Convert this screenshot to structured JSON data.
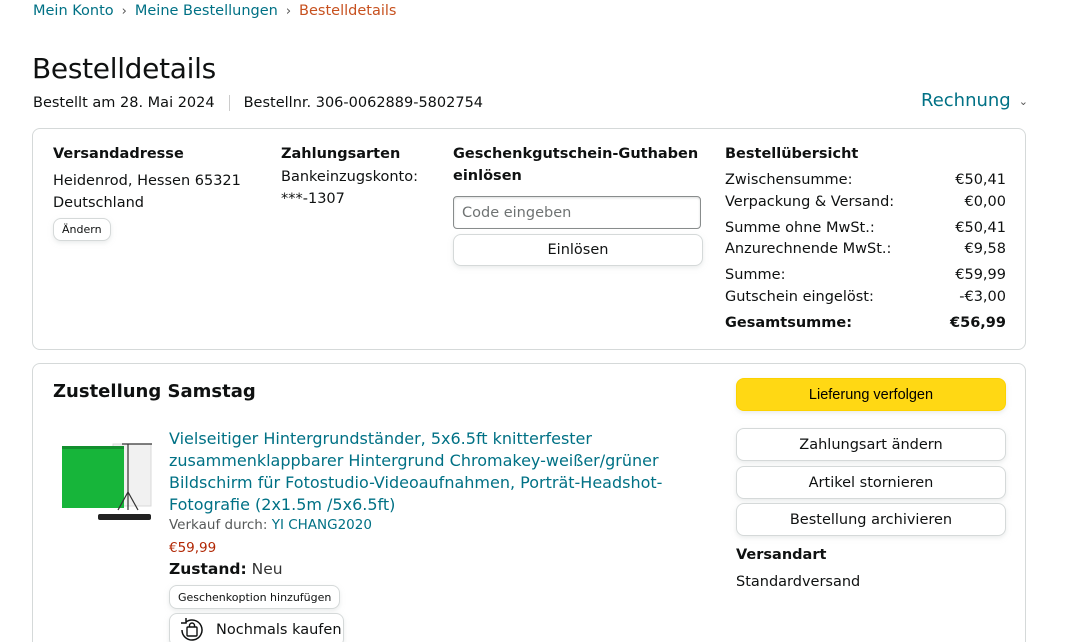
{
  "breadcrumb": {
    "items": [
      "Mein Konto",
      "Meine Bestellungen"
    ],
    "current": "Bestelldetails",
    "separator": "›"
  },
  "page_title": "Bestelldetails",
  "order_meta": {
    "date": "Bestellt am 28. Mai 2024",
    "number": "Bestellnr. 306-0062889-5802754"
  },
  "invoice_label": "Rechnung",
  "shipping": {
    "heading": "Versandadresse",
    "line1": "Heidenrod, Hessen 65321",
    "line2": "Deutschland",
    "change_label": "Ändern"
  },
  "payment": {
    "heading": "Zahlungsarten",
    "method": "Bankeinzugskonto:",
    "account": "***-1307"
  },
  "gift_card": {
    "heading_line1": "Geschenkgutschein-Guthaben",
    "heading_line2": "einlösen",
    "placeholder": "Code eingeben",
    "redeem_label": "Einlösen"
  },
  "summary": {
    "heading": "Bestellübersicht",
    "rows": [
      {
        "label": "Zwischensumme:",
        "value": "€50,41"
      },
      {
        "label": "Verpackung & Versand:",
        "value": "€0,00"
      },
      {
        "label": "Summe ohne MwSt.:",
        "value": "€50,41"
      },
      {
        "label": "Anzurechnende MwSt.:",
        "value": "€9,58"
      },
      {
        "label": "Summe:",
        "value": "€59,99"
      },
      {
        "label": "Gutschein eingelöst:",
        "value": "-€3,00"
      }
    ],
    "total": {
      "label": "Gesamtsumme:",
      "value": "€56,99"
    }
  },
  "delivery": {
    "heading": "Zustellung Samstag",
    "product": {
      "title_lines": [
        "Vielseitiger Hintergrundständer, 5x6.5ft knitterfester",
        "zusammenklappbarer Hintergrund Chromakey-weißer/grüner",
        "Bildschirm für Fotostudio-Videoaufnahmen, Porträt-Headshot-",
        "Fotografie (2x1.5m /5x6.5ft)"
      ],
      "seller_prefix": "Verkauf durch:",
      "seller": "YI CHANG2020",
      "price": "€59,99",
      "condition_label": "Zustand:",
      "condition": "Neu",
      "gift_option_label": "Geschenkoption hinzufügen",
      "buy_again_label": "Nochmals kaufen"
    },
    "actions": {
      "track": "Lieferung verfolgen",
      "change_payment": "Zahlungsart ändern",
      "cancel": "Artikel stornieren",
      "archive": "Bestellung archivieren"
    },
    "shipping_method": {
      "heading": "Versandart",
      "value": "Standardversand"
    }
  },
  "colors": {
    "link": "#007185",
    "price": "#B12704",
    "current_crumb": "#C7511F",
    "track_button": "#FFD814"
  },
  "icons": [
    "chevron-down-icon",
    "buy-again-icon",
    "product-thumbnail"
  ]
}
